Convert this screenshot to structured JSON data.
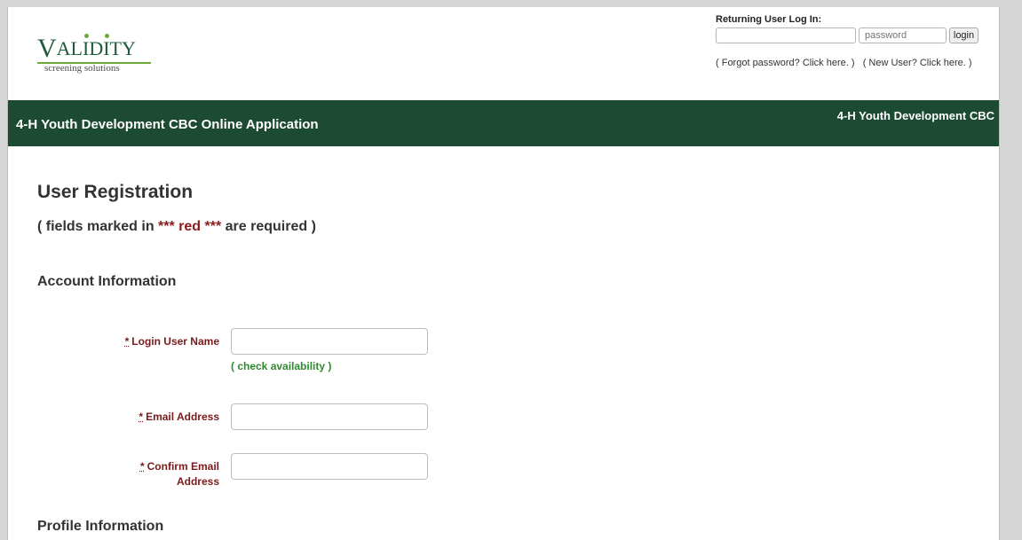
{
  "header": {
    "logo_word": "VALIDITY",
    "logo_tagline": "screening solutions",
    "login": {
      "label": "Returning User Log In:",
      "username_value": "",
      "password_placeholder": "password",
      "login_button": "login",
      "forgot_link": "( Forgot password? Click here. )",
      "new_user_link": "( New User? Click here. )"
    }
  },
  "banner": {
    "title": "4-H Youth Development CBC Online Application",
    "right_text": "4-H Youth Development CBC"
  },
  "form": {
    "title": "User Registration",
    "required_note_pre": "( fields marked in ",
    "required_note_red": "*** red ***",
    "required_note_post": " are required )",
    "account_section": "Account Information",
    "profile_section": "Profile Information",
    "fields": [
      {
        "star": "*",
        "label": "Login User Name",
        "value": ""
      },
      {
        "star": "*",
        "label": "Email Address",
        "value": ""
      },
      {
        "star": "*",
        "label": "Confirm Email Address",
        "value": ""
      }
    ],
    "check_availability": "( check availability )"
  },
  "colors": {
    "banner_bg": "#1d4a32",
    "required_red": "#7a1a1a",
    "link_green": "#2e8a2e",
    "logo_green": "#1e5a3c"
  }
}
